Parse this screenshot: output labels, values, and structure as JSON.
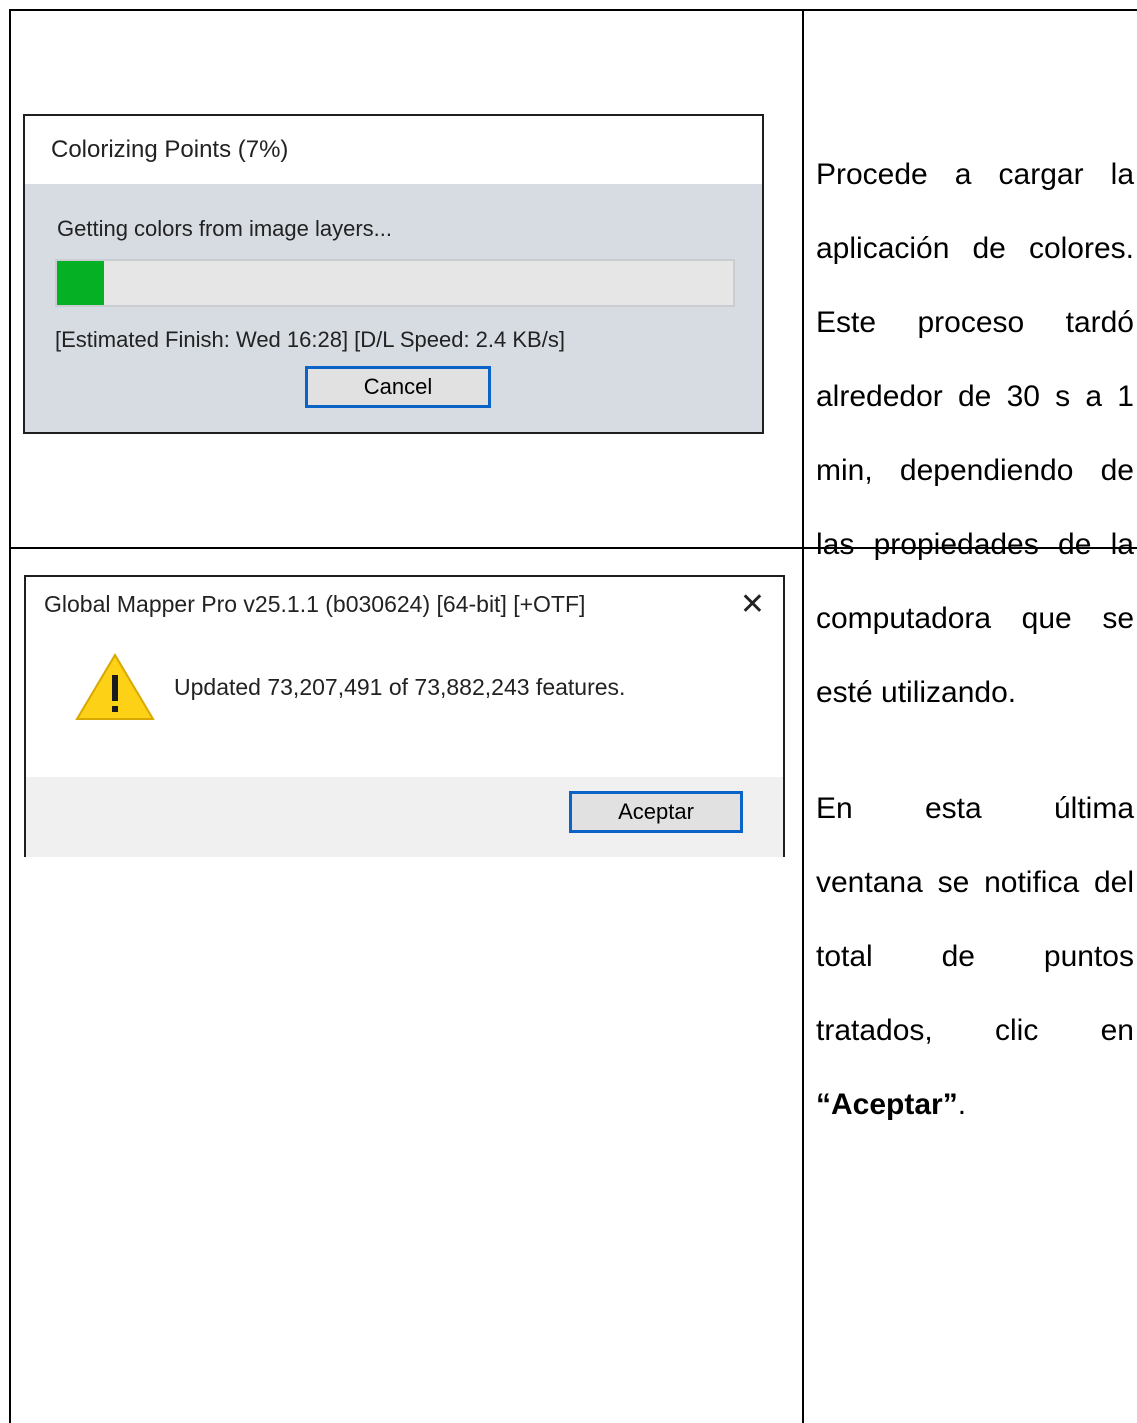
{
  "row1": {
    "dialog": {
      "title": "Colorizing Points (7%)",
      "message": "Getting colors from image layers...",
      "progress": 0.07,
      "status": "[Estimated Finish: Wed 16:28] [D/L Speed: 2.4 KB/s]",
      "cancel_label": "Cancel",
      "accent_color": "#06b025"
    },
    "text_lines": [
      "Procede a cargar la",
      "aplicación de colores.",
      "Este proceso tardó",
      "alrededor de 30 s a 1",
      "min, dependiendo de",
      "las propiedades de la",
      "computadora que se",
      "esté utilizando."
    ]
  },
  "row2": {
    "dialog": {
      "title": "Global Mapper Pro v25.1.1 (b030624) [64-bit] [+OTF]",
      "close_icon": "close-icon",
      "warning_icon": "warning-icon",
      "message": "Updated 73,207,491 of 73,882,243 features.",
      "ok_label": "Aceptar"
    },
    "text_lines": [
      "En esta última",
      "ventana se notifica del",
      "total de puntos",
      "tratados, clic en"
    ],
    "text_bold": "“Aceptar”",
    "text_tail": "."
  }
}
